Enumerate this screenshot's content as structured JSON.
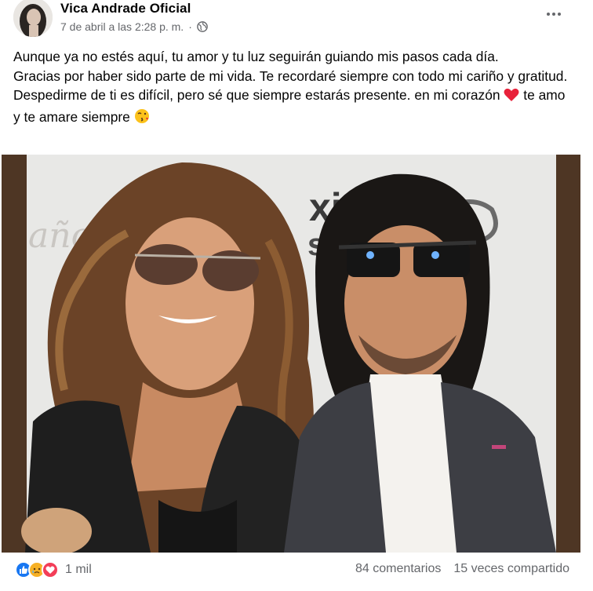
{
  "post": {
    "author": "Vica Andrade Oficial",
    "timestamp": "7 de abril a las 2:28 p. m.",
    "separator": "·",
    "privacy_icon": "globe-icon",
    "more_icon": "more-options-icon"
  },
  "body": {
    "line1": "Aunque ya no estés aquí, tu amor y tu luz seguirán guiando mis pasos cada día.",
    "line2": "Gracias por haber sido parte de mi vida. Te recordaré siempre con todo mi cariño y gratitud.",
    "line3_a": "Despedirme de ti es difícil, pero sé que siempre estarás presente. en mi corazón",
    "line3_emoji": "❤️",
    "line3_b": " te amo y te amare siempre",
    "line3_emoji2": "😘"
  },
  "photo": {
    "backdrop_text_left": "año",
    "backdrop_text_right": "xim",
    "backdrop_text_right2": "sl"
  },
  "footer": {
    "reaction_icons": [
      "like-icon",
      "sad-icon",
      "love-icon"
    ],
    "reaction_count": "1 mil",
    "comments": "84 comentarios",
    "shares": "15 veces compartido"
  },
  "colors": {
    "text": "#050505",
    "secondary": "#65676b",
    "like": "#1877f2",
    "love": "#f33e58",
    "sad": "#f7b125",
    "photo_border": "#4e3624"
  }
}
